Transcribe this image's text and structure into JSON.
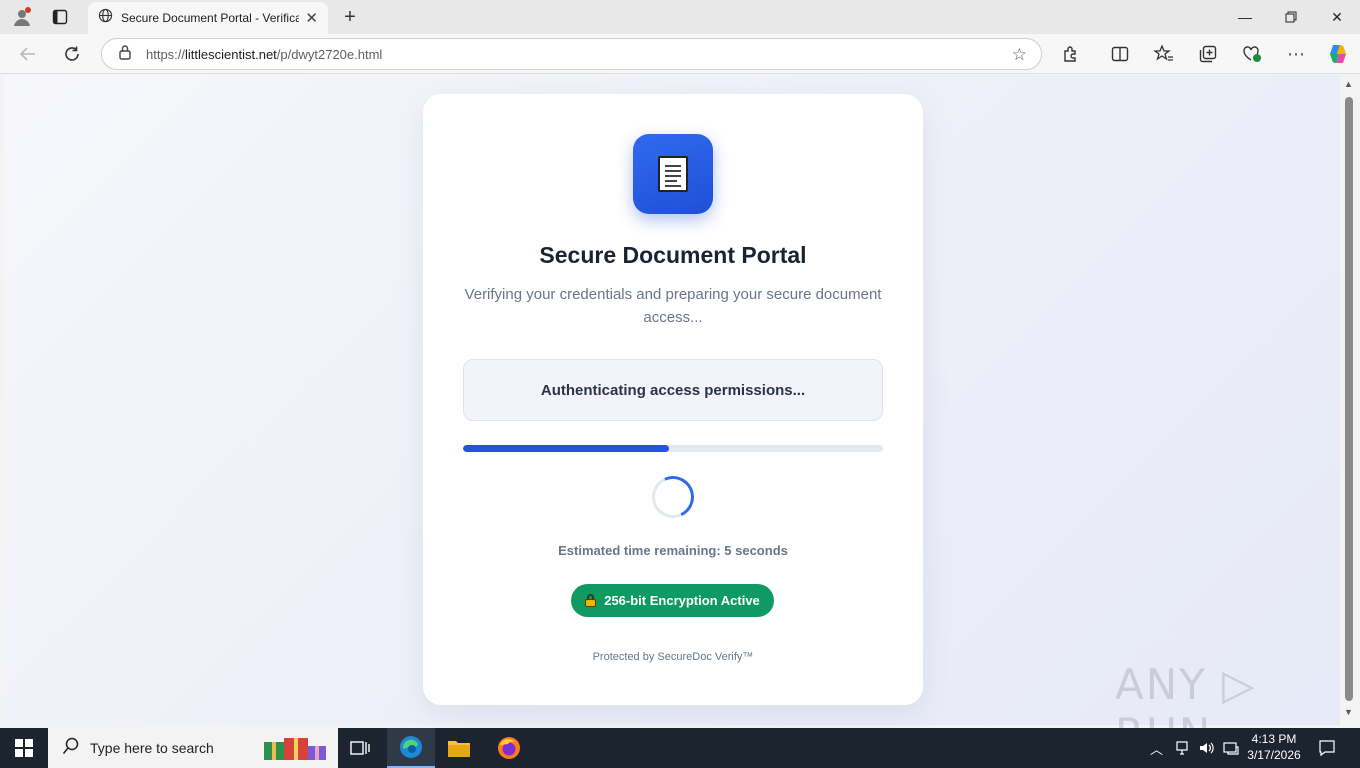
{
  "browser": {
    "tab_title": "Secure Document Portal - Verification",
    "url_host": "littlescientist.net",
    "url_prefix": "https://",
    "url_path": "/p/dwyt2720e.html"
  },
  "page": {
    "title": "Secure Document Portal",
    "subtitle": "Verifying your credentials and preparing your secure document access...",
    "status": "Authenticating access permissions...",
    "progress_fraction": 0.49,
    "eta": "Estimated time remaining: 5 seconds",
    "encryption_badge": "256-bit Encryption Active",
    "footer": "Protected by SecureDoc Verify™"
  },
  "watermark": "ANY RUN",
  "taskbar": {
    "search_placeholder": "Type here to search",
    "time": "4:13 PM",
    "date": "3/17/2026"
  },
  "colors": {
    "accent": "#2255d9",
    "encryption_badge": "#0f9a63"
  }
}
